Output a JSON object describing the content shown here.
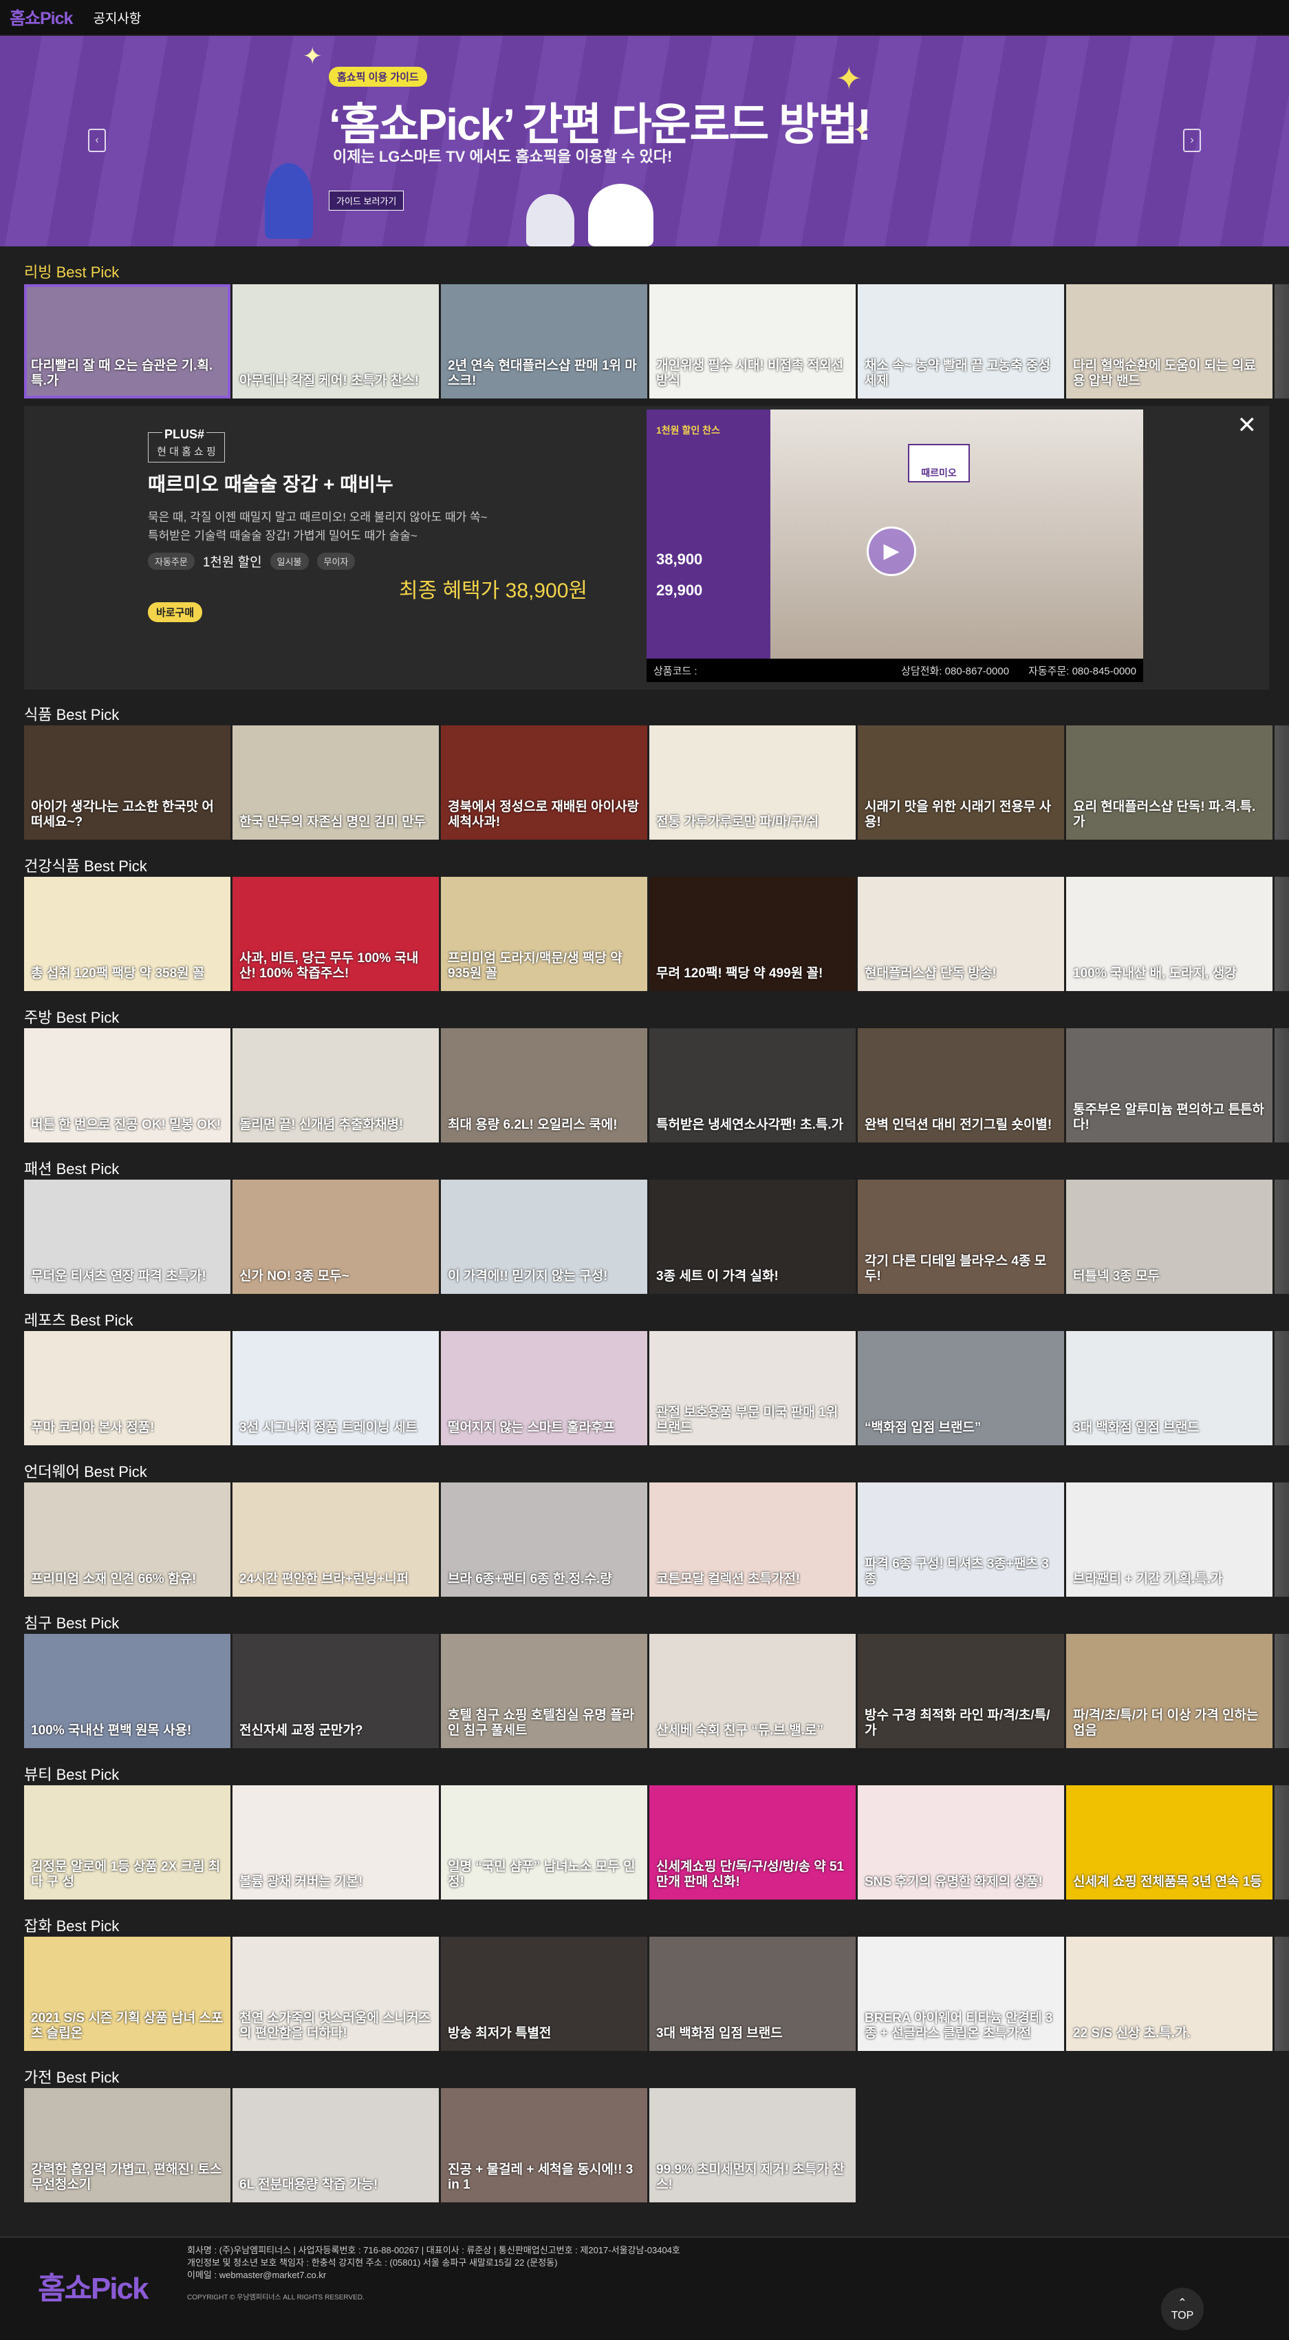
{
  "header": {
    "logo": "홈쇼Pick",
    "nav_notice": "공지사항"
  },
  "banner": {
    "tag": "홈쇼픽 이용 가이드",
    "title": "‘홈쇼Pick’ 간편 다운로드 방법!",
    "subtitle": "이제는 LG스마트 TV 에서도 홈쇼픽을 이용할 수 있다!",
    "button": "가이드 보러가기",
    "prev_icon": "chevron-left-icon",
    "next_icon": "chevron-right-icon"
  },
  "detail": {
    "brand_plus": "PLUS#",
    "brand_name": "현 대 홈 쇼 핑",
    "title": "때르미오 때술술 장갑 + 때비누",
    "desc_line1": "묵은 때, 각질 이젠 때밀지 말고 때르미오! 오래 불리지 않아도 때가 쏙~",
    "desc_line2": "특허받은 기술력 때술술 장갑! 가볍게 밀어도 때가 술술~",
    "chip1": "자동주문",
    "chip_main": "1천원 할인",
    "chip2": "일시불",
    "chip3": "무이자",
    "final_price": "최종 혜택가 38,900원",
    "buy_button": "바로구매",
    "product_code": "상품코드 :",
    "consult_phone": "상담전화: 080-867-0000",
    "auto_order": "자동주문: 080-845-0000",
    "video_brand": "때르미오",
    "video_price1": "38,900",
    "video_price2": "29,900",
    "video_discount": "1천원 할인 찬스"
  },
  "sections": [
    {
      "title": "리빙 Best Pick",
      "items": [
        {
          "caption": "다리빨리 잘 때 오는 습관은 기.획.특.가",
          "bg": "#8e7aa0"
        },
        {
          "caption": "아무데나 각질 케어! 초특가 찬스!",
          "bg": "#dfe3da"
        },
        {
          "caption": "2년 연속 현대플러스샵 판매 1위 마스크!",
          "bg": "#7f8f9c"
        },
        {
          "caption": "개인위생 필수 시대! 비접촉 적외선 방식",
          "bg": "#f2f2ee"
        },
        {
          "caption": "채소 속~ 농약 빨래 끝 고농축 중성세제",
          "bg": "#e6ecef"
        },
        {
          "caption": "다리 혈액순환에 도움이 되는 의료용 압박 밴드",
          "bg": "#d8cfbf"
        }
      ]
    },
    {
      "title": "식품 Best Pick",
      "items": [
        {
          "caption": "아이가 생각나는 고소한 한국맛 어떠세요~?",
          "bg": "#4a3a2e"
        },
        {
          "caption": "한국 만두의 자존심 명인 김미 만두",
          "bg": "#ccc5b2"
        },
        {
          "caption": "경북에서 정성으로 재배된 아이사랑 세척사과!",
          "bg": "#7a2b22"
        },
        {
          "caption": "전통 가루가루로만 파/마/구/쉬",
          "bg": "#efe9dc"
        },
        {
          "caption": "시래기 맛을 위한 시래기 전용무 사용!",
          "bg": "#5a4a36"
        },
        {
          "caption": "요리 현대플러스샵 단독! 파.격.특.가",
          "bg": "#6b6a58"
        }
      ]
    },
    {
      "title": "건강식품 Best Pick",
      "items": [
        {
          "caption": "총 섭취 120팩 팩당 약 358원 꼴",
          "bg": "#f2e8c8"
        },
        {
          "caption": "사과, 비트, 당근 무두 100% 국내산! 100% 착즙주스!",
          "bg": "#c8253b"
        },
        {
          "caption": "프리미엄 도라지/맥문/생 팩당 약 935원 꼴",
          "bg": "#d9c79a"
        },
        {
          "caption": "무려 120팩! 팩당 약 499원 꼴!",
          "bg": "#2b1a12"
        },
        {
          "caption": "현대플러스샵 단독 방송!",
          "bg": "#ece6dc"
        },
        {
          "caption": "100% 국내산 배, 도라지, 생강",
          "bg": "#f1efec"
        }
      ]
    },
    {
      "title": "주방 Best Pick",
      "items": [
        {
          "caption": "버튼 한 번으로 진공 OK! 밀봉 OK!",
          "bg": "#f2ebe4"
        },
        {
          "caption": "돌리면 끝! 신개념 추출화채병!",
          "bg": "#e0dcd3"
        },
        {
          "caption": "최대 용량 6.2L! 오일리스 쿡에!",
          "bg": "#8a7e72"
        },
        {
          "caption": "특허받은 냉세연소사각팬! 초.특.가",
          "bg": "#3a3938"
        },
        {
          "caption": "완벽 인덕션 대비 전기그릴 숏이별!",
          "bg": "#5c4e40"
        },
        {
          "caption": "통주부은 알루미늄 편의하고 튼튼하다!",
          "bg": "#6a6663"
        }
      ]
    },
    {
      "title": "패션 Best Pick",
      "items": [
        {
          "caption": "무더운 티셔츠 연장 파격 초특가!",
          "bg": "#dadada"
        },
        {
          "caption": "신가 NO! 3종 모두~",
          "bg": "#c2a78c"
        },
        {
          "caption": "이 가격에!! 믿기지 않는 구성!",
          "bg": "#cfd6dc"
        },
        {
          "caption": "3종 세트 이 가격 실화!",
          "bg": "#2e2a28"
        },
        {
          "caption": "각기 다른 디테일 블라우스 4종 모두!",
          "bg": "#6e5a4b"
        },
        {
          "caption": "터틀넥 3종 모두",
          "bg": "#cac6bf"
        }
      ]
    },
    {
      "title": "레포츠 Best Pick",
      "items": [
        {
          "caption": "푸마 코리아 본사 정품!",
          "bg": "#efe8da"
        },
        {
          "caption": "3선 시그니처 정품 트레이닝 세트",
          "bg": "#e7ecf2"
        },
        {
          "caption": "떨어지지 않는 스마트 훌라후프",
          "bg": "#dcc8d6"
        },
        {
          "caption": "관절 보호용품 부문 미국 판매 1위 브랜드",
          "bg": "#e8e3de"
        },
        {
          "caption": "“백화점 입점 브랜드”",
          "bg": "#8a8f96"
        },
        {
          "caption": "3대 백화점 입점 브랜드",
          "bg": "#e7ebee"
        }
      ]
    },
    {
      "title": "언더웨어 Best Pick",
      "items": [
        {
          "caption": "프리미엄 소재 인견 66% 함유!",
          "bg": "#d9d2c4"
        },
        {
          "caption": "24시간 편안한 브라+런닝+니퍼",
          "bg": "#e6d9c2"
        },
        {
          "caption": "브라 6종+팬티 6종 한.정.수.량",
          "bg": "#bfbcbb"
        },
        {
          "caption": "코튼모달 컬렉션 초특가전!",
          "bg": "#ecd8d0"
        },
        {
          "caption": "파격 6종 구성! 티셔츠 3종+팬츠 3종",
          "bg": "#e4e8ee"
        },
        {
          "caption": "브라팬티 + 기간 기.획.특.가",
          "bg": "#eeeeee"
        }
      ]
    },
    {
      "title": "침구 Best Pick",
      "items": [
        {
          "caption": "100% 국내산 편백 원목 사용!",
          "bg": "#7d8aa4"
        },
        {
          "caption": "전신자세 교정 군만가?",
          "bg": "#3e3c3d"
        },
        {
          "caption": "호텔 침구 쇼핑 호텔침실 유명 플라인 침구 풀세트",
          "bg": "#a39a8d"
        },
        {
          "caption": "산세베 숙회 친구 “듀.브.밸.로”",
          "bg": "#e2dcd4"
        },
        {
          "caption": "방수 구경 최적화 라인 파/격/초/특/가",
          "bg": "#3f3a35"
        },
        {
          "caption": "파/격/초/특/가 더 이상 가격 인하는 업음",
          "bg": "#b79f7c"
        }
      ]
    },
    {
      "title": "뷰티 Best Pick",
      "items": [
        {
          "caption": "김정문 알로에 1등 상품 2X 크림 최 다 구 성",
          "bg": "#ebe4c7"
        },
        {
          "caption": "볼륨 광채 커버는 기본!",
          "bg": "#f2ece8"
        },
        {
          "caption": "일명 “국민 샴푸” 남녀노소 모두 인정!",
          "bg": "#eef0e6"
        },
        {
          "caption": "신세계쇼핑 단/독/구/성/방/송 약 51만개 판매 신화!",
          "bg": "#d6238a"
        },
        {
          "caption": "SNS 후기의 유명한 화제의 상품!",
          "bg": "#f4e4e6"
        },
        {
          "caption": "신세계 쇼핑 전체품목 3년 연속 1등",
          "bg": "#f0c100"
        }
      ]
    },
    {
      "title": "잡화 Best Pick",
      "items": [
        {
          "caption": "2021 S/S 시즌 기획 상품 남녀 스포츠 슬립온",
          "bg": "#ecd48a"
        },
        {
          "caption": "천연 소가죽의 멋스러움에 스니커즈의 편안함을 더하다!",
          "bg": "#ebe7e0"
        },
        {
          "caption": "방송 최저가 특별전",
          "bg": "#3a3432"
        },
        {
          "caption": "3대 백화점 입점 브랜드",
          "bg": "#6a625e"
        },
        {
          "caption": "BRERA 아이웨어 티타늄 안경테 3종 + 선글라스 클립온 초특가전",
          "bg": "#f1f1f1"
        },
        {
          "caption": "22 S/S 신상 초.특.가.",
          "bg": "#efe6d8"
        }
      ]
    },
    {
      "title": "가전 Best Pick",
      "items": [
        {
          "caption": "강력한 흡입력 가볍고, 편해진! 토스 무선청소기",
          "bg": "#c3bcb1"
        },
        {
          "caption": "6L 전분대용량 착즙 가능!",
          "bg": "#d8d4cf"
        },
        {
          "caption": "진공 + 물걸레 + 세척을 동시에!! 3 in 1",
          "bg": "#7d6a63"
        },
        {
          "caption": "99.9% 초미세먼지 제거! 초특가 찬스!",
          "bg": "#d9d6d2"
        }
      ]
    }
  ],
  "footer": {
    "logo": "홈쇼Pick",
    "info_line1": "회사명 : (주)우남엠피티너스 | 사업자등록번호 : 716-88-00267 | 대표이사 : 류준상 | 통신판매업신고번호 : 제2017-서울강남-03404호",
    "info_line2": "개인정보 및 청소년 보호 책임자 : 한충석 강지현 주소 : (05801) 서울 송파구 새말로15길 22 (문정동)",
    "info_line3": "이메일 : webmaster@market7.co.kr",
    "copyright": "COPYRIGHT © 우남엠피티너스 ALL RIGHTS RESERVED.",
    "top_button": "TOP"
  }
}
